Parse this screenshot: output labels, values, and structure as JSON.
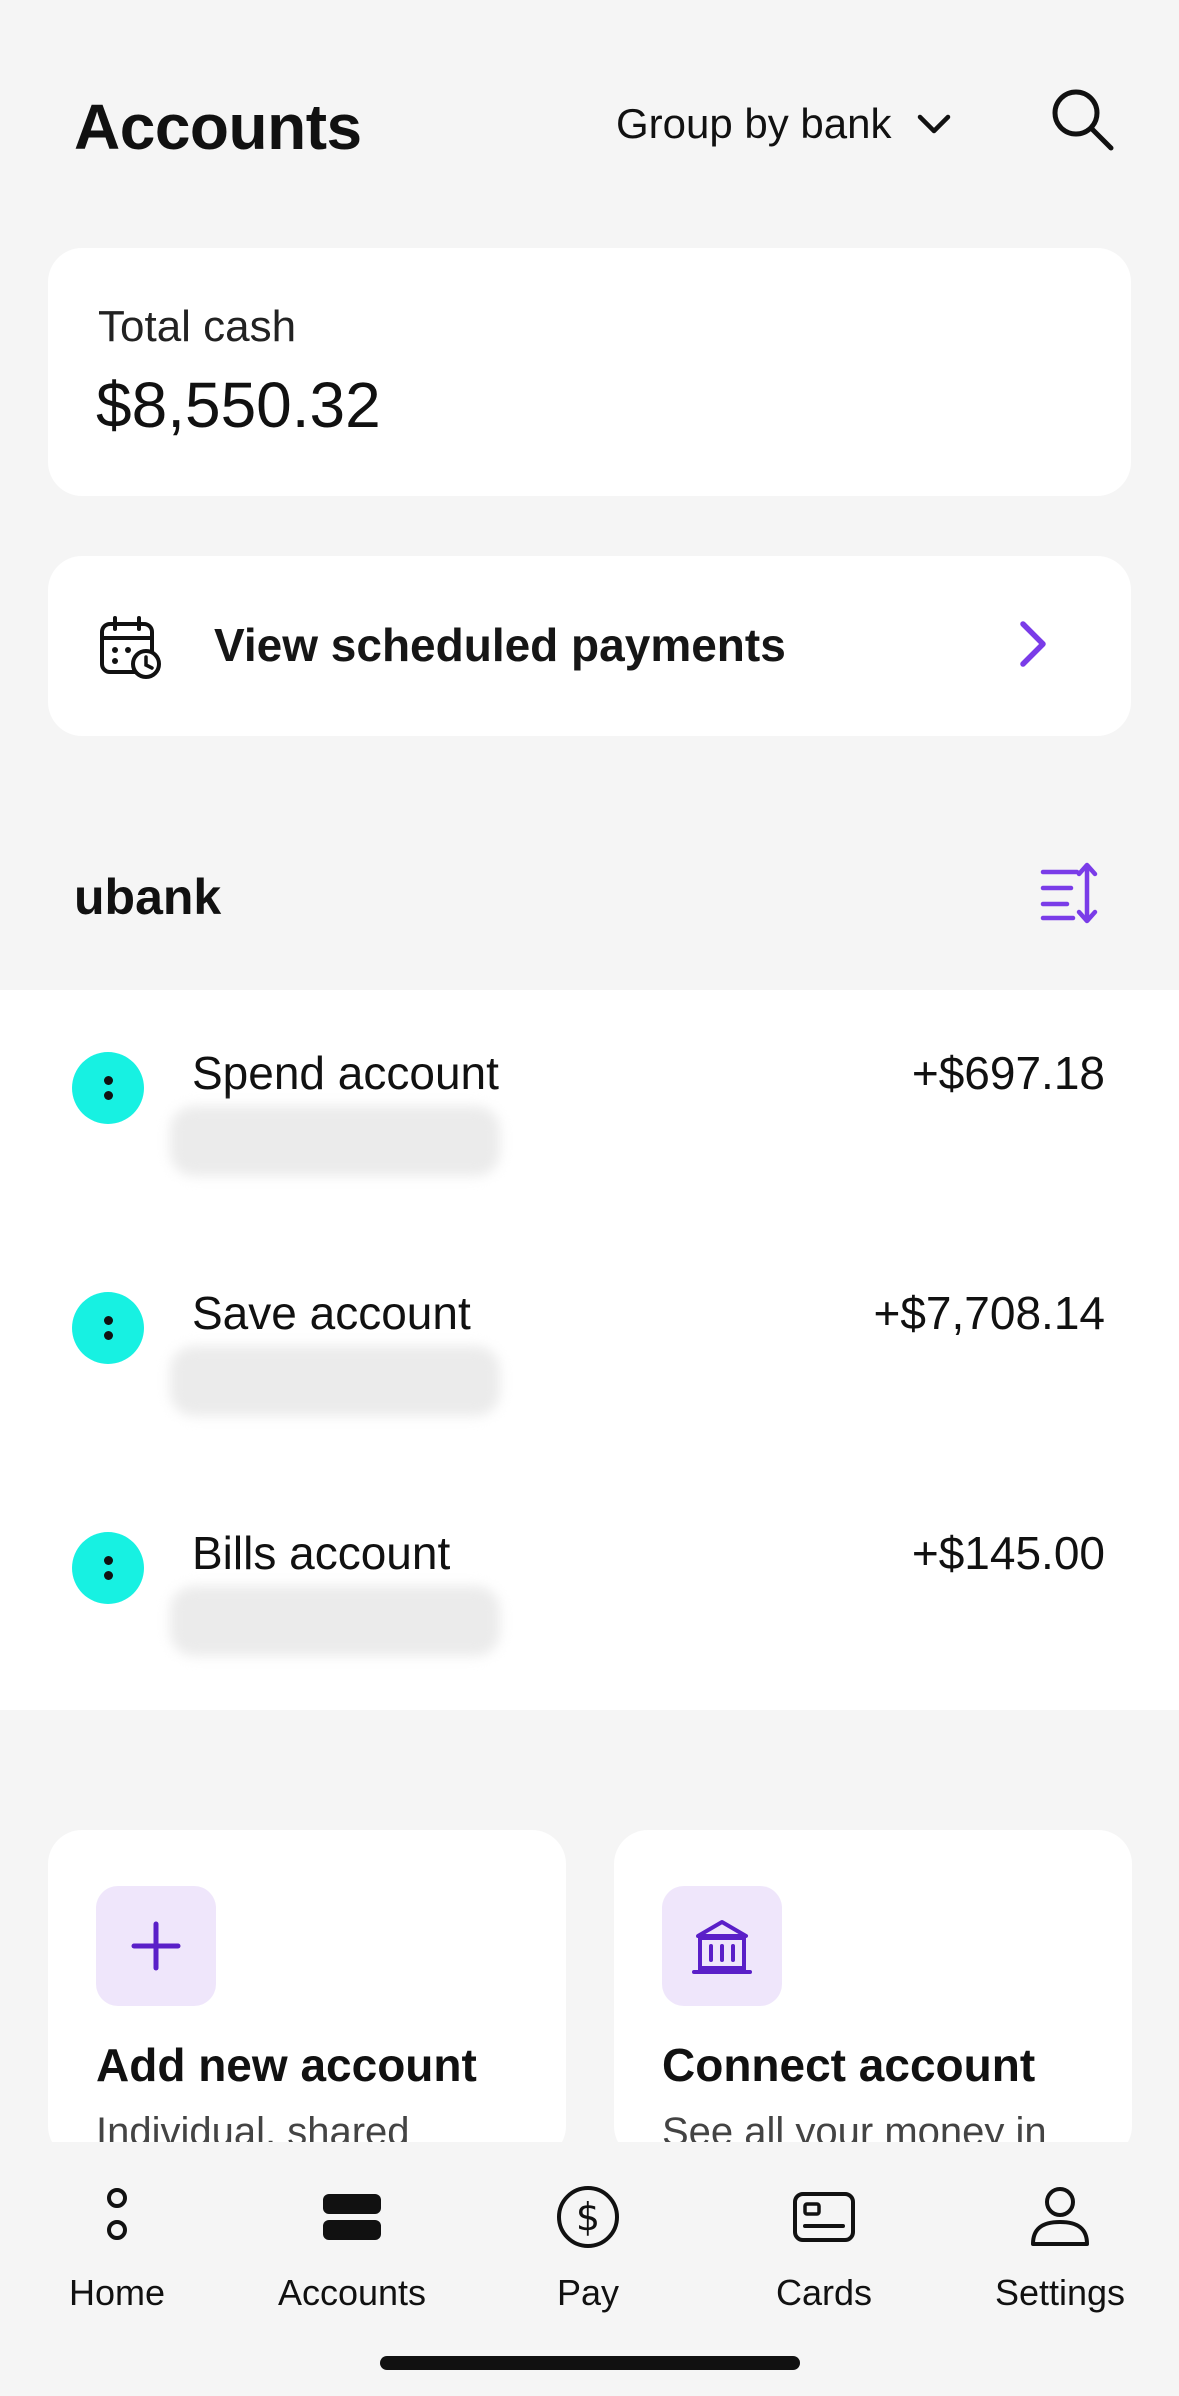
{
  "header": {
    "title": "Accounts",
    "group_by_label": "Group by bank"
  },
  "total": {
    "label": "Total cash",
    "value": "$8,550.32"
  },
  "scheduled": {
    "label": "View scheduled payments"
  },
  "bank": {
    "name": "ubank",
    "accounts": [
      {
        "name": "Spend account",
        "amount": "+$697.18"
      },
      {
        "name": "Save account",
        "amount": "+$7,708.14"
      },
      {
        "name": "Bills account",
        "amount": "+$145.00"
      }
    ]
  },
  "actions": {
    "add": {
      "title": "Add new account",
      "subtitle": "Individual, shared"
    },
    "connect": {
      "title": "Connect account",
      "subtitle": "See all your money in"
    }
  },
  "nav": {
    "items": [
      {
        "label": "Home",
        "icon": "home-icon"
      },
      {
        "label": "Accounts",
        "icon": "accounts-icon"
      },
      {
        "label": "Pay",
        "icon": "dollar-icon"
      },
      {
        "label": "Cards",
        "icon": "card-icon"
      },
      {
        "label": "Settings",
        "icon": "person-icon"
      }
    ]
  },
  "colors": {
    "accent": "#7a3ce8",
    "account_dot": "#17f1e2",
    "icon_bg": "#efe6fb"
  }
}
